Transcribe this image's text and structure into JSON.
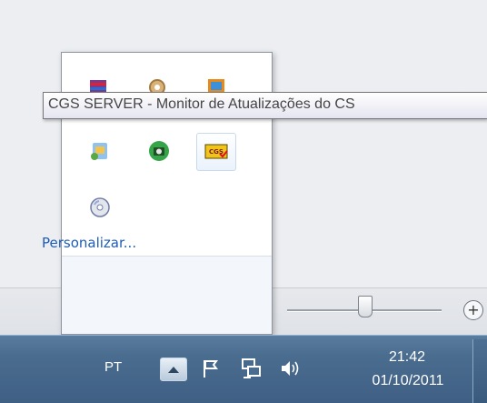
{
  "tooltip": {
    "text": "CGS SERVER - Monitor de Atualizações do CS"
  },
  "flyout": {
    "customize_label": "Personalizar...",
    "icons": [
      "winrar-icon",
      "update-gear-icon",
      "gallery-icon",
      "messenger-icon",
      "camera-icon",
      "cgs-server-icon",
      "cd-drive-icon"
    ]
  },
  "taskbar": {
    "language": "PT",
    "clock": {
      "time": "21:42",
      "date": "01/10/2011"
    },
    "tray_icons": [
      "action-center-flag-icon",
      "network-icon",
      "volume-icon"
    ]
  },
  "colors": {
    "taskbar": "#4a6c8f",
    "link": "#1f5cb4",
    "tooltip_text": "#454545"
  }
}
